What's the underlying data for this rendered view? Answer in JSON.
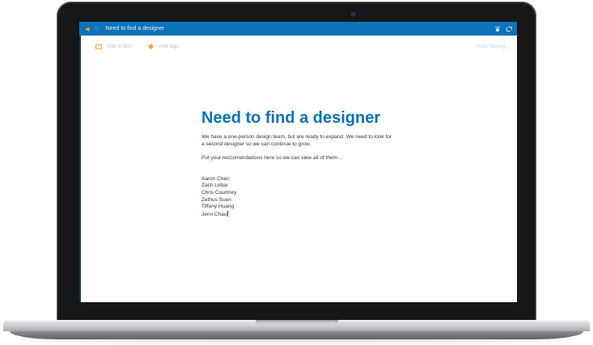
{
  "window": {
    "title": "Need to find a designer",
    "icons": [
      "back-arrow-icon",
      "heart-icon",
      "trash-icon",
      "share-icon"
    ]
  },
  "toolbar": {
    "add_to_box": "Add to Box",
    "add_tags": "Add tags",
    "autosave": "Auto Saving..."
  },
  "document": {
    "title": "Need to find a designer",
    "paragraph1": "We have a one-person design team, but are ready to expand. We need to look for a second designer so we can continue to grow.",
    "paragraph2": "Put your reccomendations here so we can view all of them...",
    "names": [
      "Aaron Chen",
      "Zach Lebar",
      "Chris Courtney",
      "Zethus Suen",
      "Tiffany Huang",
      "Jenn Chau"
    ]
  },
  "colors": {
    "accent": "#0c72b9",
    "icon_orange": "#f5a623",
    "body_text": "#2d3a46"
  }
}
